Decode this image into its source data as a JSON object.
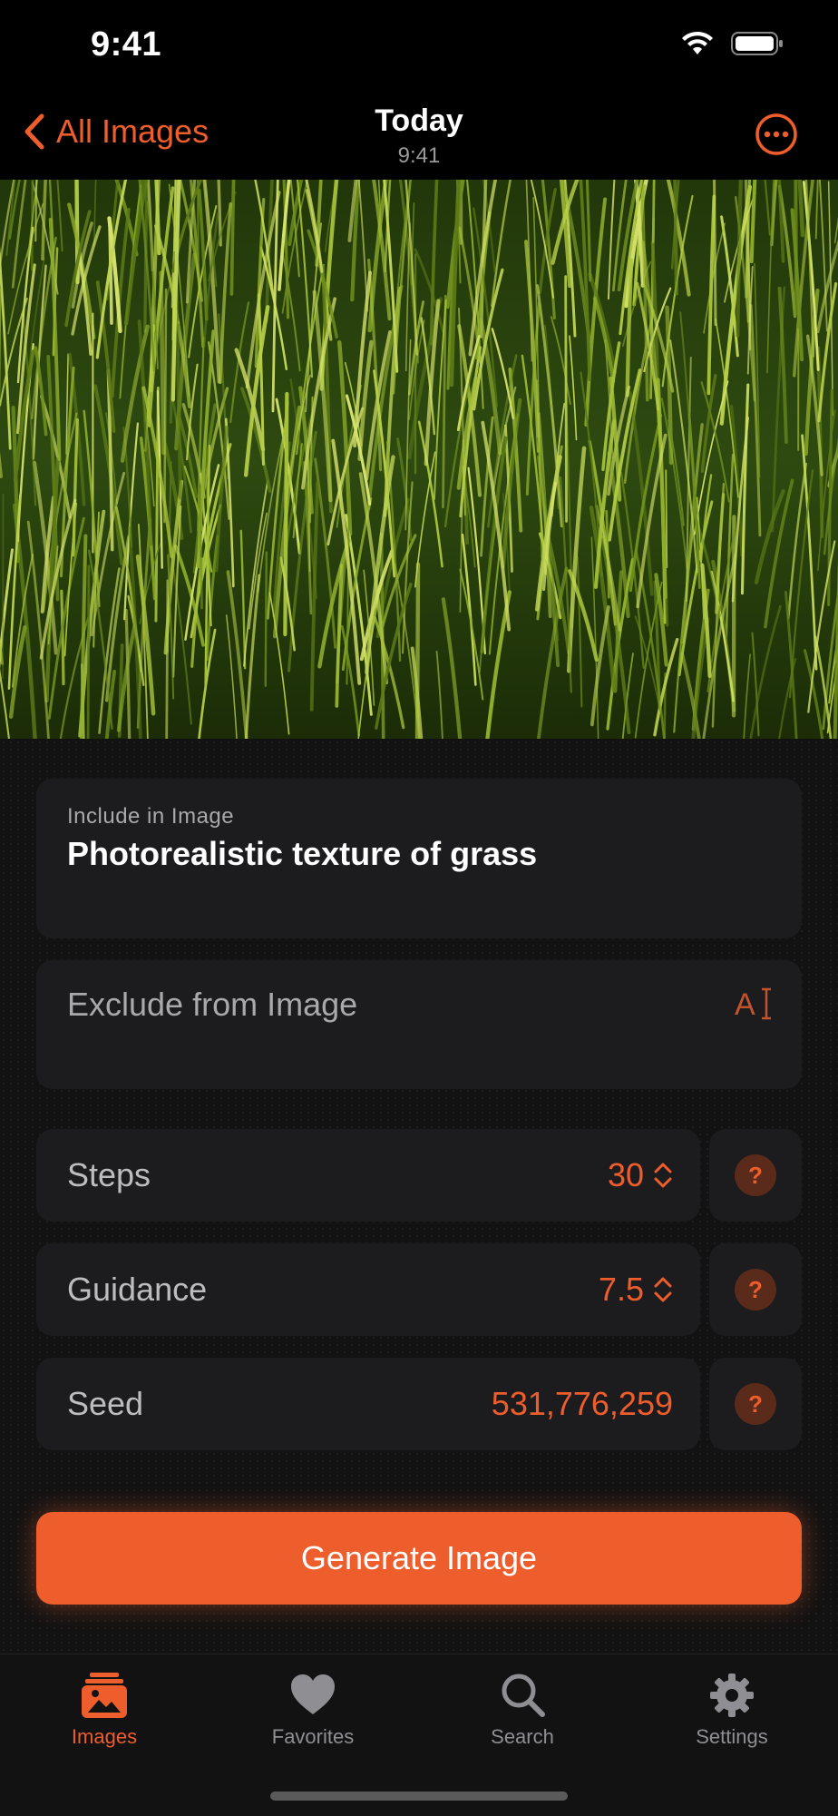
{
  "status_bar": {
    "time": "9:41"
  },
  "nav": {
    "back_label": "All Images",
    "title": "Today",
    "subtitle": "9:41"
  },
  "form": {
    "include_label": "Include in Image",
    "include_value": "Photorealistic texture of grass",
    "exclude_placeholder": "Exclude from Image",
    "rows": [
      {
        "label": "Steps",
        "value": "30"
      },
      {
        "label": "Guidance",
        "value": "7.5"
      },
      {
        "label": "Seed",
        "value": "531,776,259"
      }
    ],
    "help_symbol": "?"
  },
  "generate_button": {
    "label": "Generate Image"
  },
  "tabs": [
    {
      "label": "Images",
      "icon": "images-icon",
      "active": true
    },
    {
      "label": "Favorites",
      "icon": "heart-icon",
      "active": false
    },
    {
      "label": "Search",
      "icon": "magnifier-icon",
      "active": false
    },
    {
      "label": "Settings",
      "icon": "gear-icon",
      "active": false
    }
  ],
  "colors": {
    "accent": "#ee5d2c",
    "card": "#1c1c1e",
    "background": "#000000"
  }
}
